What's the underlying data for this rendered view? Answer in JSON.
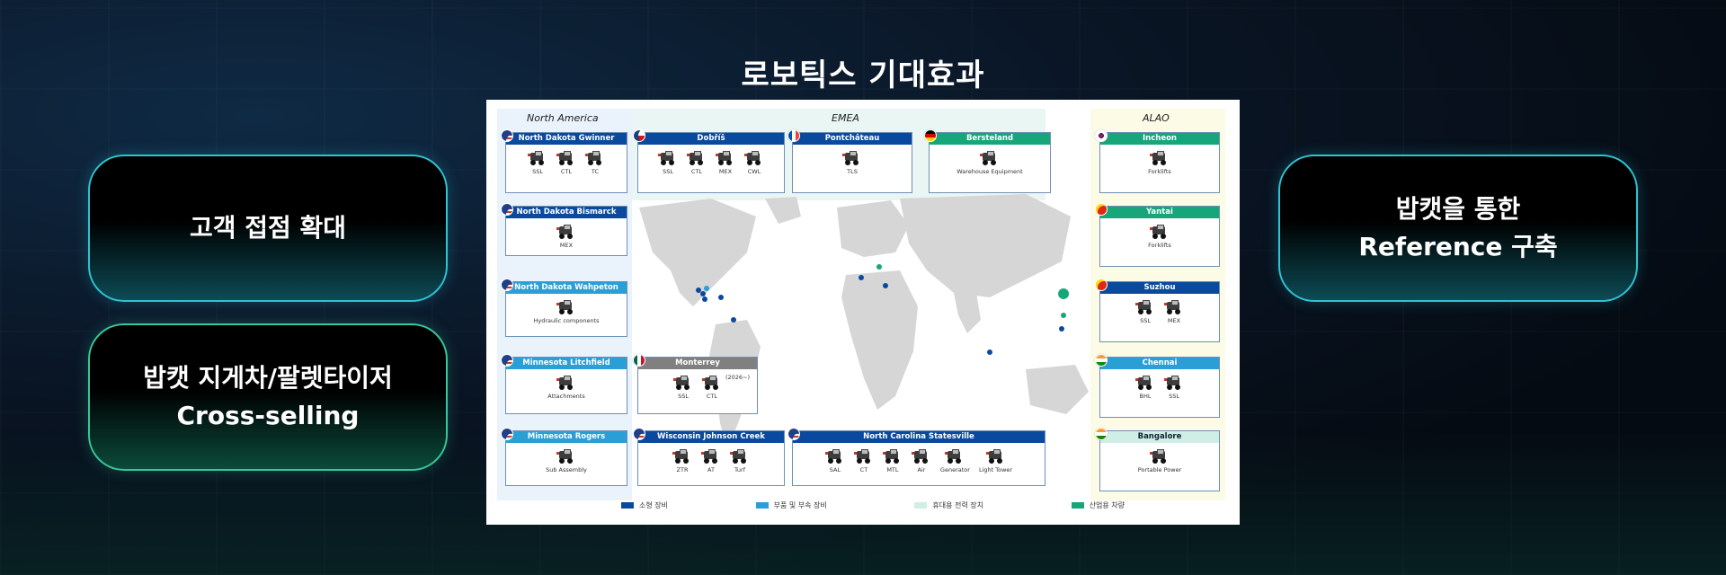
{
  "page": {
    "title": "로보틱스 기대효과"
  },
  "left_pills": [
    {
      "lines": [
        "고객 접점 확대"
      ]
    },
    {
      "lines": [
        "밥캣 지게차/팔렛타이저",
        "Cross-selling"
      ]
    }
  ],
  "right_pills": [
    {
      "lines": [
        "밥캣을 통한",
        "Reference 구축"
      ]
    }
  ],
  "map": {
    "regions": {
      "north_america": "North America",
      "emea": "EMEA",
      "alao": "ALAO"
    },
    "colors": {
      "navy": "#0a4a9e",
      "sky": "#2a9fd6",
      "grey": "#808080",
      "green": "#16a67a",
      "emea_bg": "#eaf6f3",
      "na_bg": "#eaf2fb",
      "alao_bg": "#fbfbe6",
      "land": "#d6d6d6"
    },
    "sites": [
      {
        "name": "North Dakota Gwinner",
        "flag": "us",
        "items": [
          "SSL",
          "CTL",
          "TC"
        ]
      },
      {
        "name": "North Dakota Bismarck",
        "flag": "us",
        "items": [
          "MEX"
        ]
      },
      {
        "name": "North Dakota Wahpeton",
        "flag": "us",
        "items": [
          "Hydraulic components"
        ]
      },
      {
        "name": "Minnesota Litchfield",
        "flag": "us",
        "items": [
          "Attachments"
        ]
      },
      {
        "name": "Minnesota Rogers",
        "flag": "us",
        "items": [
          "Sub Assembly"
        ]
      },
      {
        "name": "Dobříš",
        "flag": "cz",
        "items": [
          "SSL",
          "CTL",
          "MEX",
          "CWL"
        ]
      },
      {
        "name": "Pontchâteau",
        "flag": "fr",
        "items": [
          "TLS"
        ]
      },
      {
        "name": "Bersteland",
        "flag": "de",
        "items": [
          "Warehouse Equipment"
        ]
      },
      {
        "name": "Monterrey",
        "flag": "mx",
        "items": [
          "SSL",
          "CTL"
        ],
        "note": "(2026~)"
      },
      {
        "name": "Wisconsin Johnson Creek",
        "flag": "us",
        "items": [
          "ZTR",
          "AT",
          "Turf"
        ]
      },
      {
        "name": "North Carolina Statesville",
        "flag": "us",
        "items": [
          "SAL",
          "CT",
          "MTL",
          "Air",
          "Generator",
          "Light Tower"
        ]
      },
      {
        "name": "Incheon",
        "flag": "kr",
        "items": [
          "Forklifts"
        ]
      },
      {
        "name": "Yantai",
        "flag": "cn",
        "items": [
          "Forklifts"
        ]
      },
      {
        "name": "Suzhou",
        "flag": "cn",
        "items": [
          "SSL",
          "MEX"
        ]
      },
      {
        "name": "Chennai",
        "flag": "in",
        "items": [
          "BHL",
          "SSL"
        ]
      },
      {
        "name": "Bangalore",
        "flag": "in",
        "items": [
          "Portable Power"
        ]
      }
    ],
    "legend": [
      {
        "label": "소형 장비",
        "color": "#0a4a9e"
      },
      {
        "label": "부품 및 부속 장비",
        "color": "#2a9fd6"
      },
      {
        "label": "휴대용 전력 장치",
        "color": "#cfeee6"
      },
      {
        "label": "산업용 차량",
        "color": "#16a67a"
      }
    ]
  }
}
